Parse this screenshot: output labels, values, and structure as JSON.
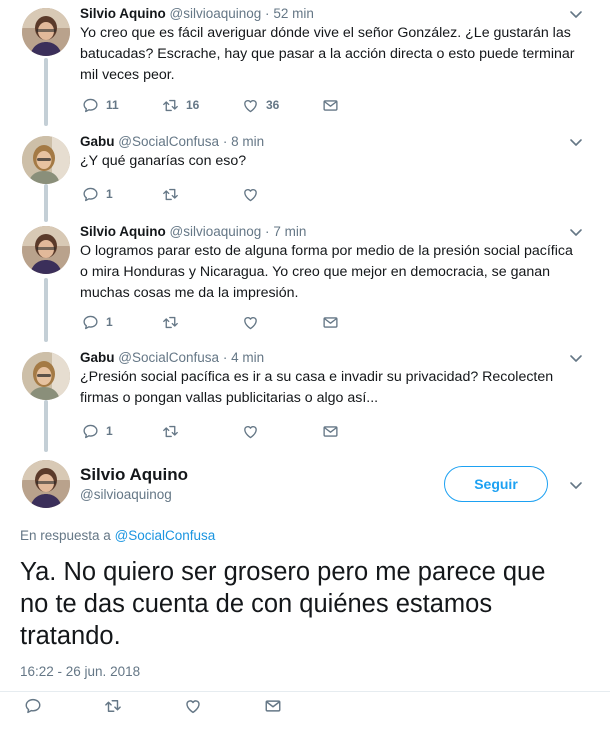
{
  "tweets": [
    {
      "name": "Silvio Aquino",
      "handle": "@silvioaquinog",
      "dot": "·",
      "time": "52 min",
      "text": "Yo creo que es fácil averiguar dónde vive el señor González. ¿Le gustarán las batucadas? Escrache, hay que pasar a la acción directa o esto puede terminar mil veces peor.",
      "replies": "11",
      "retweets": "16",
      "likes": "36"
    },
    {
      "name": "Gabu",
      "handle": "@SocialConfusa",
      "dot": "·",
      "time": "8 min",
      "text": "¿Y qué ganarías con eso?",
      "replies": "1",
      "retweets": "",
      "likes": ""
    },
    {
      "name": "Silvio Aquino",
      "handle": "@silvioaquinog",
      "dot": "·",
      "time": "7 min",
      "text": "O logramos parar esto de alguna forma por medio de la presión social pacífica o mira Honduras y Nicaragua. Yo creo que mejor en democracia, se ganan muchas cosas me da la impresión.",
      "replies": "1",
      "retweets": "",
      "likes": ""
    },
    {
      "name": "Gabu",
      "handle": "@SocialConfusa",
      "dot": "·",
      "time": "4 min",
      "text": "¿Presión social pacífica es ir a su casa e invadir su privacidad? Recolecten firmas o pongan vallas publicitarias o algo así...",
      "replies": "1",
      "retweets": "",
      "likes": ""
    }
  ],
  "main": {
    "name": "Silvio Aquino",
    "handle": "@silvioaquinog",
    "follow_label": "Seguir",
    "reply_prefix": "En respuesta a ",
    "reply_mention": "@SocialConfusa",
    "text": "Ya. No quiero ser grosero pero me parece que no te das cuenta de con quiénes estamos tratando.",
    "timestamp": "16:22 - 26 jun. 2018"
  },
  "colors": {
    "accent": "#1da1f2",
    "secondary_text": "#657786",
    "thread_line": "#c4cfd6"
  },
  "icons": {
    "reply": "reply-icon",
    "retweet": "retweet-icon",
    "like": "heart-icon",
    "dm": "envelope-icon",
    "menu": "chevron-down-icon"
  }
}
